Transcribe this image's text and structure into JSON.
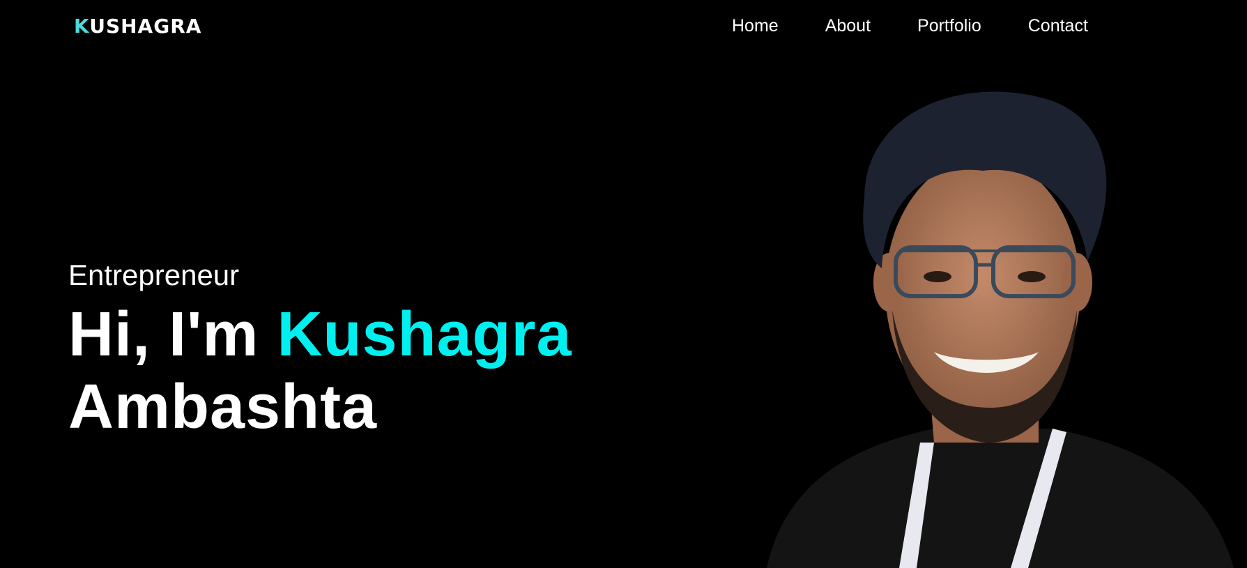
{
  "header": {
    "logo_first_letter": "K",
    "logo_rest": "USHAGRA",
    "nav": [
      {
        "label": "Home"
      },
      {
        "label": "About"
      },
      {
        "label": "Portfolio"
      },
      {
        "label": "Contact"
      }
    ]
  },
  "hero": {
    "role": "Entrepreneur",
    "greeting": "Hi, I'm",
    "first_name": "Kushagra",
    "last_name": "Ambashta",
    "portrait_icon": "person-photo"
  },
  "colors": {
    "background": "#000000",
    "accent": "#00f0f0",
    "logo_accent": "#4fd8d8",
    "text": "#ffffff"
  }
}
